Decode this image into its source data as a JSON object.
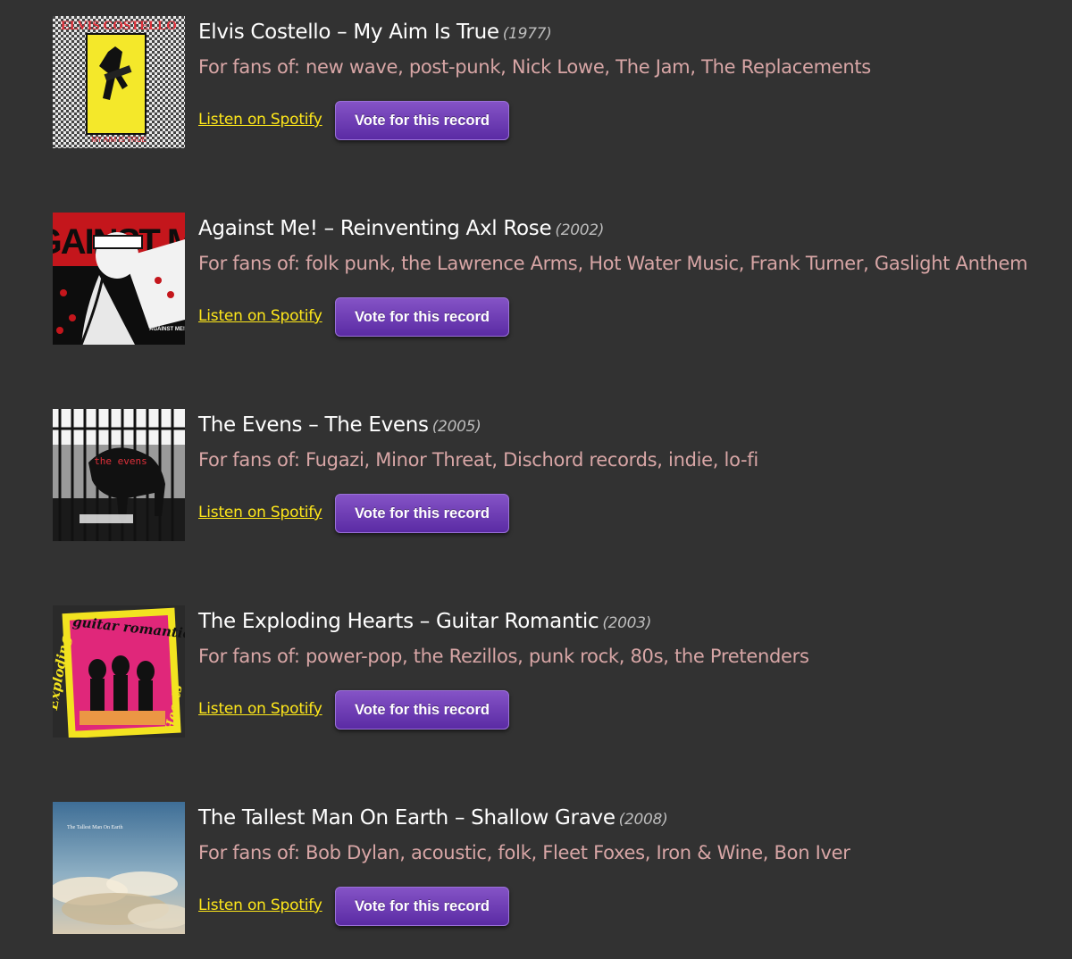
{
  "records": [
    {
      "title": "Elvis Costello – My Aim Is True",
      "year": "(1977)",
      "fans": "For fans of: new wave, post-punk, Nick Lowe, The Jam, The Replacements",
      "spotify_label": "Listen on Spotify",
      "vote_label": "Vote for this record",
      "cover_text": "ELVIS COSTELLO",
      "cover_subtext": "MY AIM IS TRUE"
    },
    {
      "title": "Against Me! – Reinventing Axl Rose",
      "year": "(2002)",
      "fans": "For fans of: folk punk, the Lawrence Arms, Hot Water Music, Frank Turner, Gaslight Anthem",
      "spotify_label": "Listen on Spotify",
      "vote_label": "Vote for this record",
      "cover_text": "AGAINST ME!",
      "cover_subtext": "AGAINST ME!"
    },
    {
      "title": "The Evens – The Evens",
      "year": "(2005)",
      "fans": "For fans of: Fugazi, Minor Threat, Dischord records, indie, lo-fi",
      "spotify_label": "Listen on Spotify",
      "vote_label": "Vote for this record",
      "cover_text": "the evens"
    },
    {
      "title": "The Exploding Hearts – Guitar Romantic",
      "year": "(2003)",
      "fans": "For fans of: power-pop, the Rezillos, punk rock, 80s, the Pretenders",
      "spotify_label": "Listen on Spotify",
      "vote_label": "Vote for this record",
      "cover_text": "guitar romantic",
      "cover_side_left": "Exploding",
      "cover_side_right": "Hearts"
    },
    {
      "title": "The Tallest Man On Earth – Shallow Grave",
      "year": "(2008)",
      "fans": "For fans of: Bob Dylan, acoustic, folk, Fleet Foxes, Iron & Wine, Bon Iver",
      "spotify_label": "Listen on Spotify",
      "vote_label": "Vote for this record",
      "cover_text": "The Tallest Man On Earth"
    }
  ],
  "colors": {
    "background": "#323232",
    "title": "#ffffff",
    "year": "#bdbdbd",
    "fans": "#d8a6a6",
    "link": "#ffe81a",
    "button": "#6b3ab4"
  }
}
